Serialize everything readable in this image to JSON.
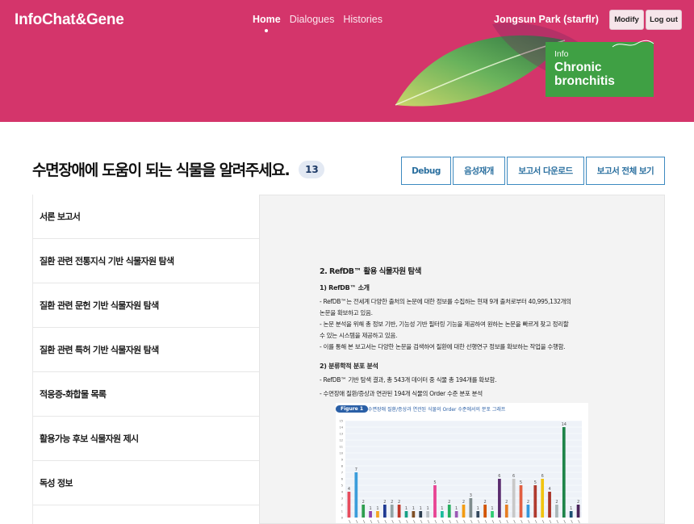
{
  "header": {
    "logo": "InfoChat&Gene",
    "nav": [
      {
        "label": "Home",
        "active": true
      },
      {
        "label": "Dialogues",
        "active": false
      },
      {
        "label": "Histories",
        "active": false
      }
    ],
    "user": "Jongsun Park (starflr)",
    "modify_label": "Modify",
    "logout_label": "Log out",
    "info_label": "Info",
    "info_disease": "Chronic bronchitis",
    "colors": {
      "banner": "#d4356b",
      "info_box": "#3fa044"
    }
  },
  "page": {
    "title": "수면장애에 도움이 되는 식물을 알려주세요.",
    "count": "13"
  },
  "actions": [
    "Debug",
    "음성재개",
    "보고서 다운로드",
    "보고서 전체 보기"
  ],
  "sidebar": {
    "items": [
      "서론 보고서",
      "질환 관련 전통지식 기반 식물자원 탐색",
      "질환 관련 문헌 기반 식물자원 탐색",
      "질환 관련 특허 기반 식물자원 탐색",
      "적응증-화합물 목록",
      "활용가능 후보 식물자원 제시",
      "독성 정보"
    ]
  },
  "report": {
    "heading": "2. RefDB™ 활용 식물자원 탐색",
    "sub1": "1) RefDB™ 소개",
    "p1": "- RefDB™는 전세계 다양한 출처의 논문에 대한 정보를 수집하는 현재 9개 출처로부터 40,995,132개의",
    "p1b": "논문을 확보하고 있음.",
    "p2": "- 논문 분석을 위해 총 정보 기반, 기능성 기반 필터링 기능을 제공하여 원하는 논문을 빠르게 찾고 정리할",
    "p2b": "수 있는 시스템을 제공하고 있음.",
    "p3": "- 이를 통해 본 보고서는 다양한 논문을 검색하여 질환에 대한 선행연구 정보를 확보하는 작업을 수행함.",
    "sub2": "2) 분류학적 분포 분석",
    "p4": "- RefDB™ 기반 탐색 결과, 총 543개 데이터 중 식물 총 194개를 확보함.",
    "p5": "- 수면장애 질환/증상과 연관된 194개 식물의 Order 수준 분포 분석",
    "figure_tag": "Figure 1",
    "figure_caption": "수면장애 질환/증상과 연관된 식물의 Order 수준에서의 분포 그래프"
  },
  "chart_data": {
    "type": "bar",
    "ylim": [
      0,
      15
    ],
    "values": [
      4,
      7,
      2,
      1,
      1,
      2,
      2,
      2,
      1,
      1,
      1,
      1,
      5,
      1,
      2,
      1,
      2,
      3,
      1,
      2,
      1,
      6,
      2,
      6,
      5,
      2,
      5,
      6,
      4,
      2,
      14,
      1,
      2
    ],
    "colors": [
      "#e74c5c",
      "#3b9ddb",
      "#2e9e4f",
      "#8e44ad",
      "#f5a623",
      "#1f3a93",
      "#95a5a6",
      "#c0392b",
      "#16a085",
      "#7f4f24",
      "#2c3e50",
      "#bdc3c7",
      "#e84393",
      "#1abc9c",
      "#27ae60",
      "#9b59b6",
      "#f39c12",
      "#7f8c8d",
      "#34495e",
      "#d35400",
      "#2ecc71",
      "#5b2c6f",
      "#e67e22",
      "#c8c8c8",
      "#e15f41",
      "#3498db",
      "#b03a2e",
      "#f1c40f",
      "#a93226",
      "#aab7b8",
      "#1e8449",
      "#1b4f72",
      "#4a235a"
    ]
  }
}
